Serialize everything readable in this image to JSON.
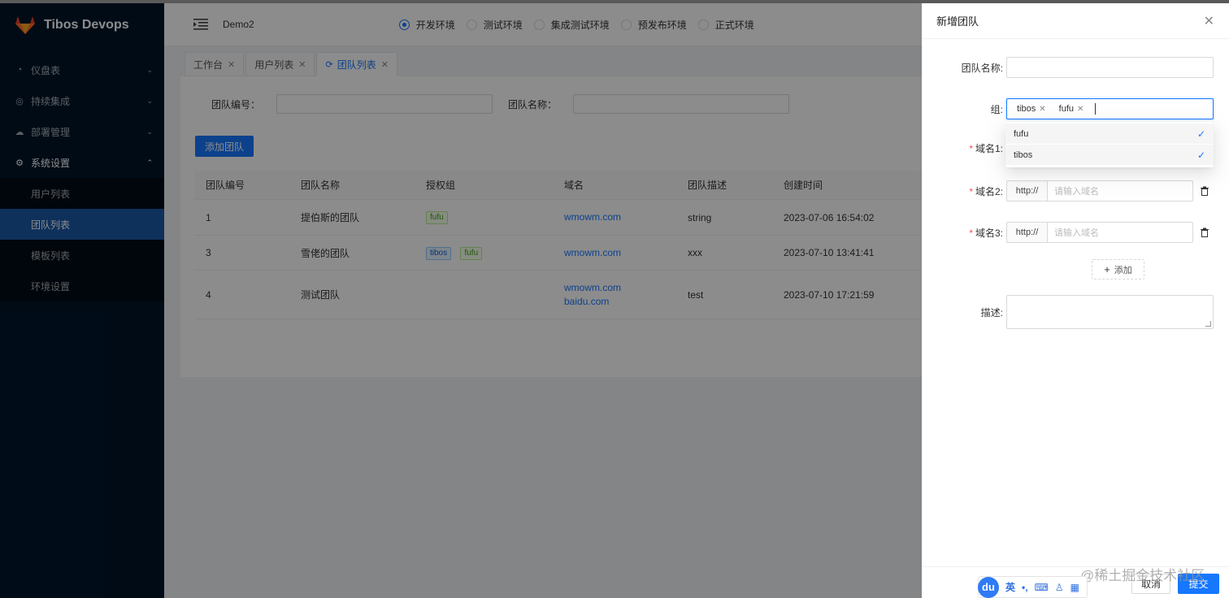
{
  "app": {
    "name": "Tibos Devops"
  },
  "sidebar": {
    "items": [
      {
        "label": "仪盘表",
        "icon": "dashboard-icon",
        "arrow": "down"
      },
      {
        "label": "持续集成",
        "icon": "integration-icon",
        "arrow": "down"
      },
      {
        "label": "部署管理",
        "icon": "cloud-icon",
        "arrow": "down"
      },
      {
        "label": "系统设置",
        "icon": "gear-icon",
        "arrow": "up"
      }
    ],
    "sub_items": [
      {
        "label": "用户列表"
      },
      {
        "label": "团队列表",
        "active": true
      },
      {
        "label": "模板列表"
      },
      {
        "label": "环境设置"
      }
    ]
  },
  "header": {
    "project": "Demo2",
    "envs": [
      {
        "label": "开发环境",
        "checked": true
      },
      {
        "label": "测试环境"
      },
      {
        "label": "集成测试环境"
      },
      {
        "label": "预发布环境"
      },
      {
        "label": "正式环境"
      }
    ]
  },
  "tabs": [
    {
      "label": "工作台"
    },
    {
      "label": "用户列表"
    },
    {
      "label": "团队列表",
      "active": true
    }
  ],
  "search": {
    "team_no_label": "团队编号：",
    "team_name_label": "团队名称："
  },
  "toolbar": {
    "add_team_label": "添加团队"
  },
  "table": {
    "columns": [
      "团队编号",
      "团队名称",
      "授权组",
      "域名",
      "团队描述",
      "创建时间"
    ],
    "rows": [
      {
        "id": "1",
        "name": "提伯斯的团队",
        "tags": [
          {
            "text": "fufu",
            "color": "green"
          }
        ],
        "domains": [
          "wmowm.com"
        ],
        "desc": "string",
        "created": "2023-07-06 16:54:02"
      },
      {
        "id": "3",
        "name": "雪佬的团队",
        "tags": [
          {
            "text": "tibos",
            "color": "blue"
          },
          {
            "text": "fufu",
            "color": "green"
          }
        ],
        "domains": [
          "wmowm.com"
        ],
        "desc": "xxx",
        "created": "2023-07-10 13:41:41"
      },
      {
        "id": "4",
        "name": "测试团队",
        "tags": [],
        "domains": [
          "wmowm.com",
          "baidu.com"
        ],
        "desc": "test",
        "created": "2023-07-10 17:21:59"
      }
    ]
  },
  "drawer": {
    "title": "新增团队",
    "form": {
      "name_label": "团队名称:",
      "group_label": "组:",
      "group_tags": [
        "tibos",
        "fufu"
      ],
      "group_options": [
        "fufu",
        "tibos"
      ],
      "domain1_label": "域名1:",
      "domain2_label": "域名2:",
      "domain3_label": "域名3:",
      "domain_prefix": "http://",
      "domain_placeholder": "请输入域名",
      "add_label": "添加",
      "desc_label": "描述:"
    },
    "cancel_label": "取消",
    "submit_label": "提交"
  },
  "watermark": "@稀土掘金技术社区",
  "ime": {
    "logo": "du",
    "lang": "英"
  },
  "colors": {
    "primary": "#1677ff",
    "sidebar": "#001529",
    "active_menu": "#1a5aa8"
  }
}
